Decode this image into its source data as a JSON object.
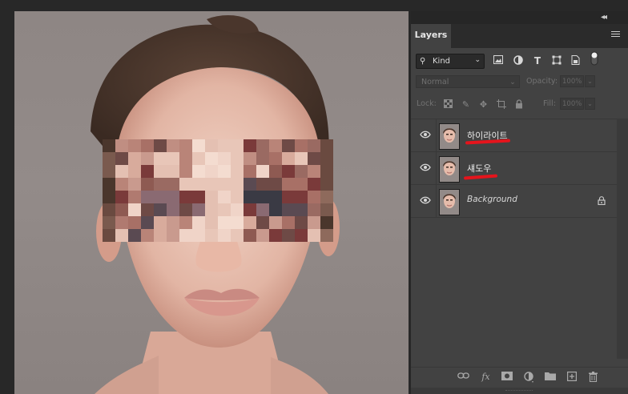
{
  "panel": {
    "collapse_icon": "double-chevron-left-icon",
    "tab_label": "Layers",
    "menu_icon": "panel-menu-icon"
  },
  "filter": {
    "kind_label": "Kind",
    "icons": [
      "image-filter-icon",
      "adjustment-filter-icon",
      "type-filter-icon",
      "shape-filter-icon",
      "smart-object-filter-icon",
      "filter-toggle-icon"
    ]
  },
  "blend": {
    "mode": "Normal",
    "opacity_label": "Opacity:",
    "opacity_value": "100%",
    "fill_label": "Fill:",
    "fill_value": "100%"
  },
  "lock": {
    "label": "Lock:",
    "icons": [
      "lock-transparent-icon",
      "lock-image-icon",
      "lock-position-icon",
      "lock-artboard-icon",
      "lock-all-icon"
    ]
  },
  "layers": [
    {
      "name": "하이라이트",
      "visible": true,
      "italic": false
    },
    {
      "name": "섀도우",
      "visible": true,
      "italic": false
    },
    {
      "name": "Background",
      "visible": true,
      "italic": true,
      "locked": true
    }
  ],
  "bottom_icons": [
    "link-layers-icon",
    "fx-icon",
    "mask-icon",
    "adjustment-layer-icon",
    "folder-icon",
    "new-layer-icon",
    "trash-icon"
  ],
  "colors": {
    "panel_bg": "#424242",
    "annotation_red": "#e5141c",
    "canvas_bg": "#8e8684"
  }
}
